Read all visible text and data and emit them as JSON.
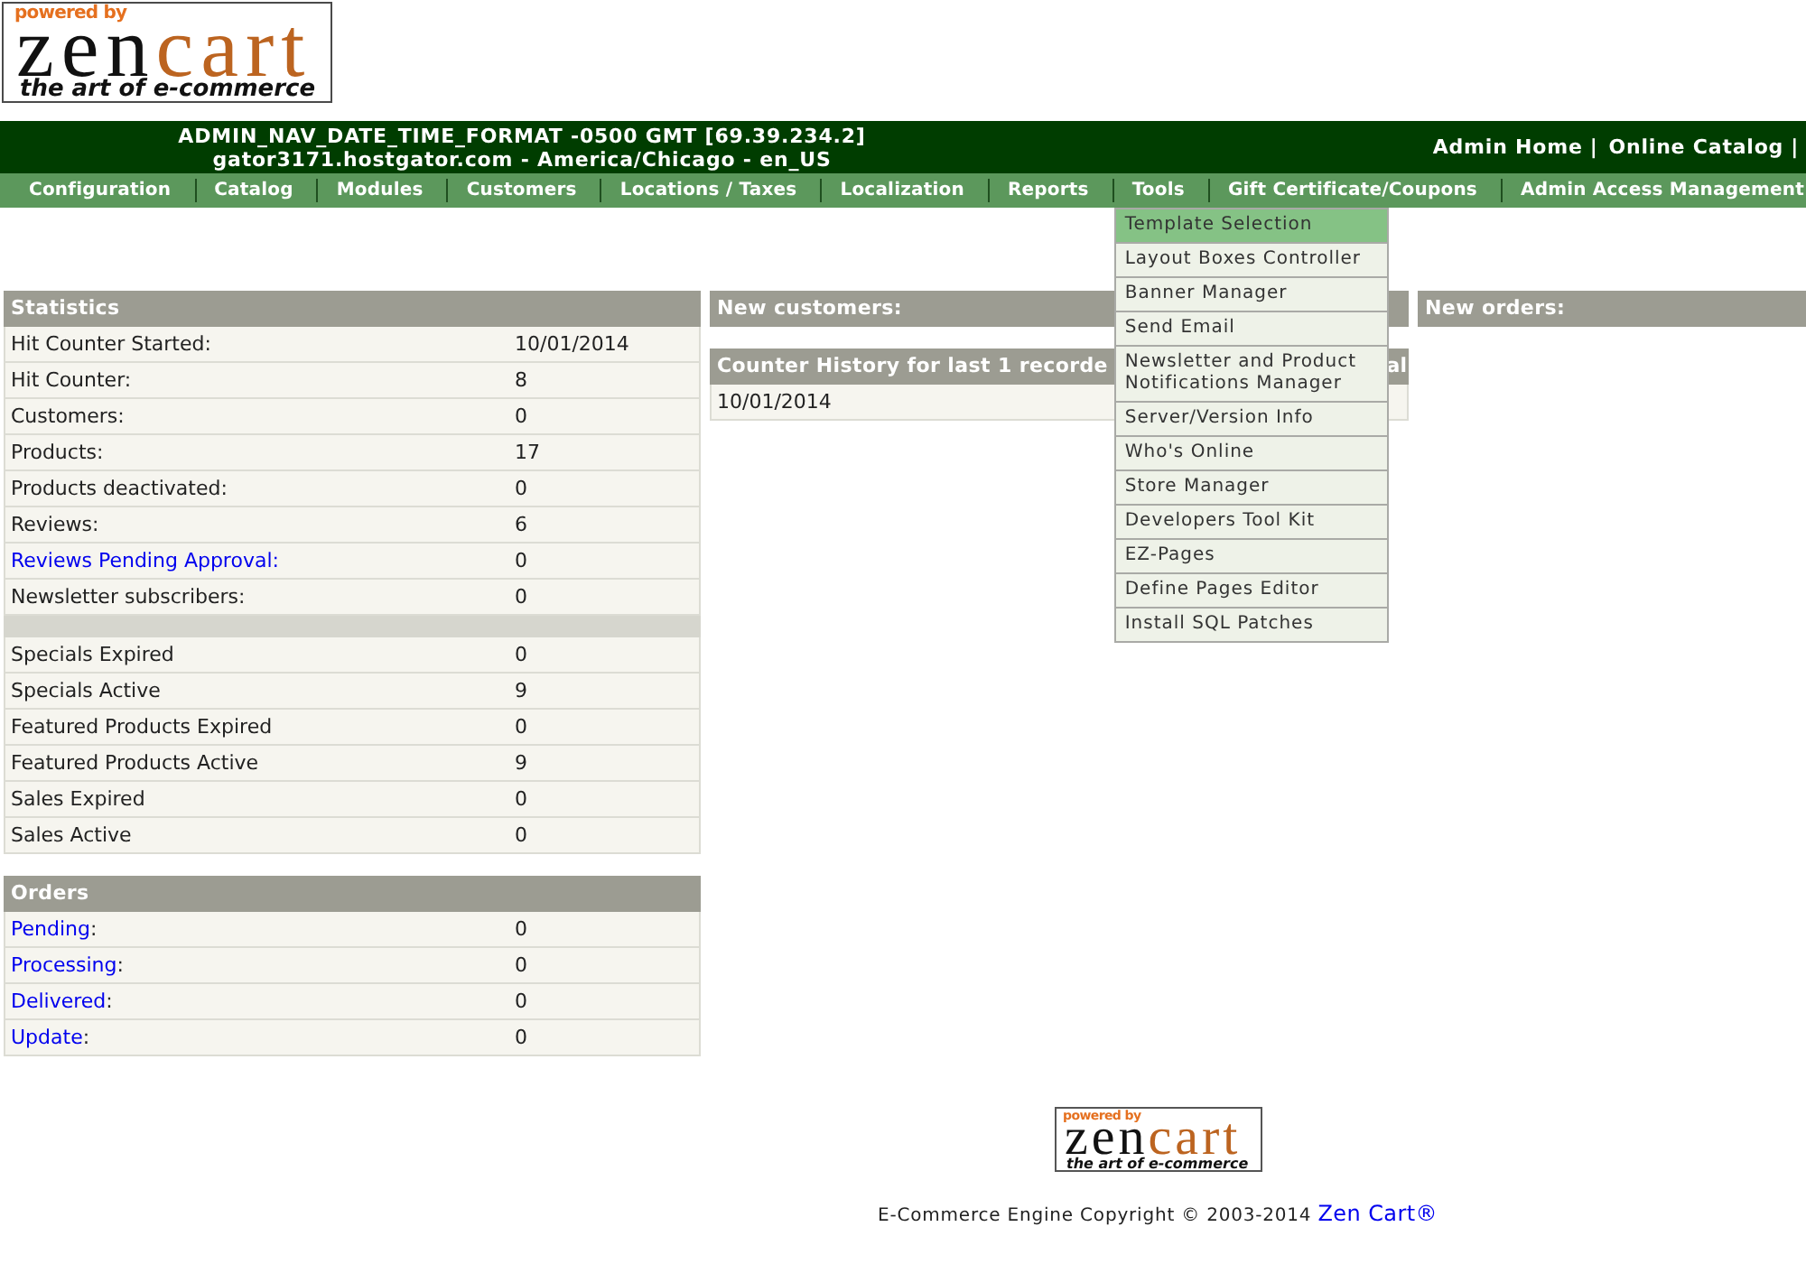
{
  "logo": {
    "badge": "powered by",
    "word_1": "zen",
    "word_2": "cart",
    "tagline": "the art of e-commerce"
  },
  "header": {
    "lines": [
      "ADMIN_NAV_DATE_TIME_FORMAT -0500 GMT [69.39.234.2]",
      "gator3171.hostgator.com - America/Chicago - en_US"
    ],
    "links": [
      {
        "label": "Admin Home",
        "separator": "|"
      },
      {
        "label": "Online Catalog",
        "separator": "|"
      }
    ]
  },
  "nav": [
    {
      "label": "Configuration"
    },
    {
      "label": "Catalog"
    },
    {
      "label": "Modules"
    },
    {
      "label": "Customers"
    },
    {
      "label": "Locations / Taxes"
    },
    {
      "label": "Localization"
    },
    {
      "label": "Reports"
    },
    {
      "label": "Tools",
      "menu": [
        {
          "label": "Template Selection",
          "selected": true
        },
        {
          "label": "Layout Boxes Controller",
          "selected": false
        },
        {
          "label": "Banner Manager",
          "selected": false
        },
        {
          "label": "Send Email",
          "selected": false
        },
        {
          "label": "Newsletter and Product Notifications Manager",
          "selected": false
        },
        {
          "label": "Server/Version Info",
          "selected": false
        },
        {
          "label": "Who's Online",
          "selected": false
        },
        {
          "label": "Store Manager",
          "selected": false
        },
        {
          "label": "Developers Tool Kit",
          "selected": false
        },
        {
          "label": "EZ-Pages",
          "selected": false
        },
        {
          "label": "Define Pages Editor",
          "selected": false
        },
        {
          "label": "Install SQL Patches",
          "selected": false
        }
      ]
    },
    {
      "label": "Gift Certificate/Coupons"
    },
    {
      "label": "Admin Access Management"
    }
  ],
  "statistics": {
    "title": "Statistics",
    "sections": [
      {
        "rows": [
          {
            "label": "Hit Counter Started:",
            "value": "10/01/2014",
            "kind": "text"
          },
          {
            "label": "Hit Counter:",
            "value": "8",
            "kind": "text"
          },
          {
            "label": "Customers:",
            "value": "0",
            "kind": "text"
          },
          {
            "label": "Products:",
            "value": "17",
            "kind": "text"
          },
          {
            "label": "Products deactivated:",
            "value": "0",
            "kind": "text"
          },
          {
            "label": "Reviews:",
            "value": "6",
            "kind": "text"
          },
          {
            "label": "Reviews Pending Approval:",
            "value": "0",
            "kind": "link"
          },
          {
            "label": "Newsletter subscribers:",
            "value": "0",
            "kind": "text"
          }
        ]
      },
      {
        "rows": [
          {
            "label": "Specials Expired",
            "value": "0",
            "kind": "text"
          },
          {
            "label": "Specials Active",
            "value": "9",
            "kind": "text"
          },
          {
            "label": "Featured Products Expired",
            "value": "0",
            "kind": "text"
          },
          {
            "label": "Featured Products Active",
            "value": "9",
            "kind": "text"
          },
          {
            "label": "Sales Expired",
            "value": "0",
            "kind": "text"
          },
          {
            "label": "Sales Active",
            "value": "0",
            "kind": "text"
          }
        ]
      }
    ]
  },
  "orders": {
    "title": "Orders",
    "rows": [
      {
        "status": "Pending",
        "suffix": ":",
        "value": "0"
      },
      {
        "status": "Processing",
        "suffix": ":",
        "value": "0"
      },
      {
        "status": "Delivered",
        "suffix": ":",
        "value": "0"
      },
      {
        "status": "Update",
        "suffix": ":",
        "value": "0"
      }
    ]
  },
  "new_customers": {
    "title": "New customers:"
  },
  "counter_history": {
    "title": "Counter History for last 1 recorde",
    "title_tail": "al",
    "rows": [
      {
        "date": "10/01/2014"
      }
    ]
  },
  "new_orders": {
    "title": "New orders:"
  },
  "footer": {
    "logo": {
      "badge": "powered by",
      "word_1": "zen",
      "word_2": "cart",
      "tagline": "the art of e-commerce"
    },
    "copyright": "E-Commerce Engine Copyright © 2003-2014",
    "link": "Zen Cart®"
  }
}
